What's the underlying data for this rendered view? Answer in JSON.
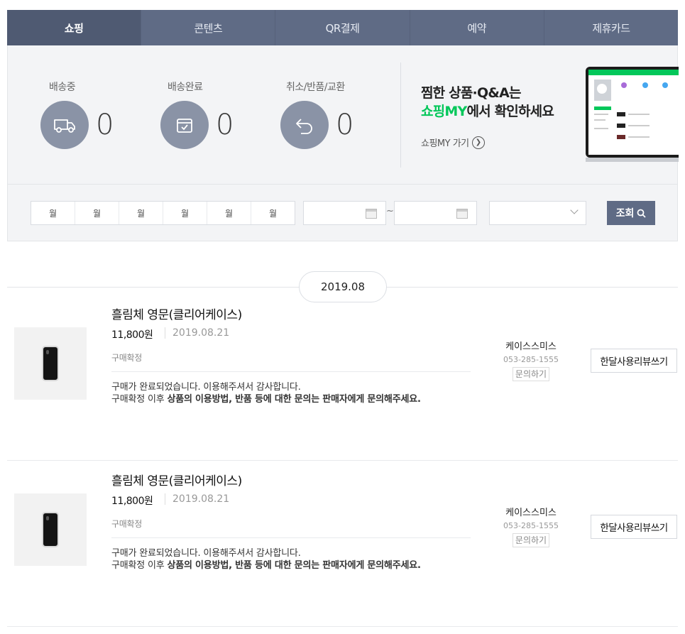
{
  "tabs": [
    {
      "label": "쇼핑",
      "active": true
    },
    {
      "label": "콘텐츠",
      "active": false
    },
    {
      "label": "QR결제",
      "active": false
    },
    {
      "label": "예약",
      "active": false
    },
    {
      "label": "제휴카드",
      "active": false
    }
  ],
  "stats": [
    {
      "label": "배송중",
      "count": "0",
      "icon": "truck-icon"
    },
    {
      "label": "배송완료",
      "count": "0",
      "icon": "box-check-icon"
    },
    {
      "label": "취소/반품/교환",
      "count": "0",
      "icon": "return-arrow-icon"
    }
  ],
  "promo": {
    "line1": "찜한 상품·Q&A는",
    "line2_green": "쇼핑MY",
    "line2_rest": "에서 확인하세요",
    "link": "쇼핑MY 가기"
  },
  "filter": {
    "months": [
      "월",
      "월",
      "월",
      "월",
      "월",
      "월"
    ],
    "tilde": "~",
    "search_label": "조회"
  },
  "date_group": "2019.08",
  "orders": [
    {
      "title": "흘림체 영문(클리어케이스)",
      "price": "11,800원",
      "date": "2019.08.21",
      "status": "구매확정",
      "msg_line1": "구매가 완료되었습니다. 이용해주셔서 감사합니다.",
      "msg_line2_a": "구매확정 이후 ",
      "msg_line2_b": "상품의 이용방법, 반품 등에 대한 문의는 판매자에게 문의해주세요.",
      "seller": "케이스스미스",
      "phone": "053-285-1555",
      "inquiry": "문의하기",
      "review": "한달사용리뷰쓰기"
    },
    {
      "title": "흘림체 영문(클리어케이스)",
      "price": "11,800원",
      "date": "2019.08.21",
      "status": "구매확정",
      "msg_line1": "구매가 완료되었습니다. 이용해주셔서 감사합니다.",
      "msg_line2_a": "구매확정 이후 ",
      "msg_line2_b": "상품의 이용방법, 반품 등에 대한 문의는 판매자에게 문의해주세요.",
      "seller": "케이스스미스",
      "phone": "053-285-1555",
      "inquiry": "문의하기",
      "review": "한달사용리뷰쓰기"
    }
  ],
  "colors": {
    "tab_bg": "#5f6b85",
    "accent_green": "#03c75a",
    "icon_circle": "#8a93a6"
  }
}
